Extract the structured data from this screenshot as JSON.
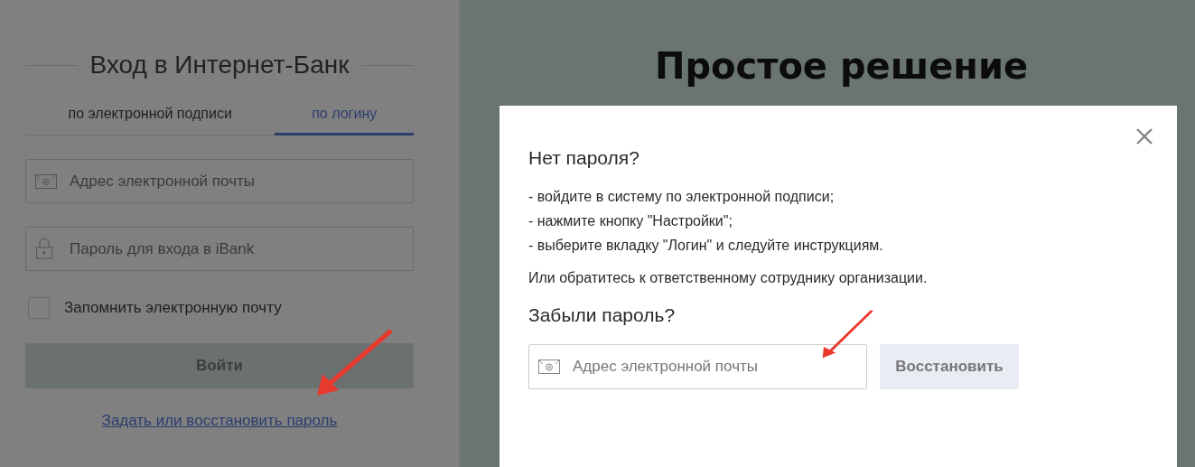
{
  "login": {
    "title": "Вход в Интернет-Банк",
    "tabs": [
      {
        "label": "по электронной подписи",
        "selected": false
      },
      {
        "label": "по логину",
        "selected": true
      }
    ],
    "fields": [
      {
        "kind": "email",
        "placeholder": "Адрес электронной почты"
      },
      {
        "kind": "password",
        "placeholder": "Пароль для входа в iBank"
      }
    ],
    "remember": {
      "label": "Запомнить электронную почту",
      "checked": false
    },
    "submit": "Войти",
    "link": "Задать или восстановить пароль"
  },
  "promo": {
    "heading": "Простое решение"
  },
  "dialog": {
    "title": "Нет пароля?",
    "steps": [
      "- войдите в систему по электронной подписи;",
      "- нажмите кнопку \"Настройки\";",
      "- выберите вкладку \"Логин\" и следуйте инструкциям."
    ],
    "note": "Или обратитесь к ответственному сотруднику организации.",
    "subtitle": "Забыли пароль?",
    "email": {
      "placeholder": "Адрес электронной почты"
    },
    "button": "Восстановить"
  }
}
